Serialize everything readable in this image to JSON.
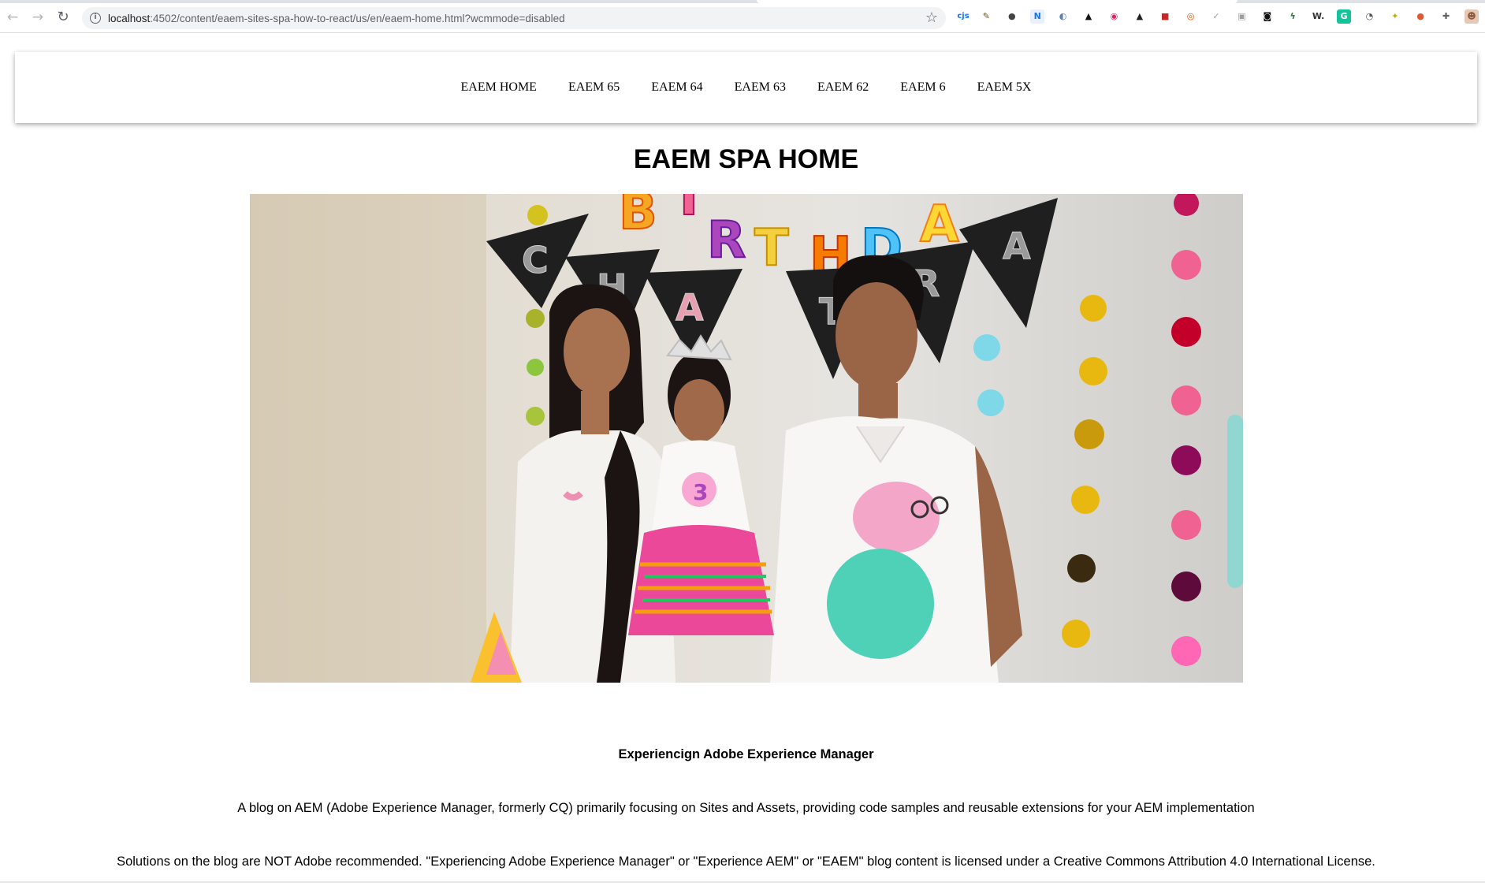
{
  "browser": {
    "url_host": "localhost",
    "url_path": ":4502/content/eaem-sites-spa-how-to-react/us/en/eaem-home.html?wcmmode=disabled",
    "icons": {
      "back": "back-arrow-icon",
      "forward": "forward-arrow-icon",
      "reload": "reload-icon",
      "site_info": "info-icon",
      "bookmark": "star-icon"
    },
    "extensions": [
      {
        "name": "cjs-extension-icon",
        "glyph": "cjs",
        "color": "#1a73e8",
        "bg": "transparent"
      },
      {
        "name": "pen-extension-icon",
        "glyph": "✎",
        "color": "#6b4e16",
        "bg": "transparent"
      },
      {
        "name": "circle-extension-icon",
        "glyph": "●",
        "color": "#444444",
        "bg": "transparent"
      },
      {
        "name": "n-extension-icon",
        "glyph": "N",
        "color": "#1a73e8",
        "bg": "#e8f0fe"
      },
      {
        "name": "compass-extension-icon",
        "glyph": "◐",
        "color": "#5b7fb5",
        "bg": "transparent"
      },
      {
        "name": "hat-extension-icon",
        "glyph": "▲",
        "color": "#111111",
        "bg": "transparent"
      },
      {
        "name": "record-extension-icon",
        "glyph": "◉",
        "color": "#e91e63",
        "bg": "transparent"
      },
      {
        "name": "drive-extension-icon",
        "glyph": "▲",
        "color": "#202124",
        "bg": "transparent"
      },
      {
        "name": "red-square-extension-icon",
        "glyph": "■",
        "color": "#c62828",
        "bg": "transparent"
      },
      {
        "name": "ring-extension-icon",
        "glyph": "◎",
        "color": "#e65100",
        "bg": "transparent"
      },
      {
        "name": "check-extension-icon",
        "glyph": "✓",
        "color": "#9e9e9e",
        "bg": "transparent"
      },
      {
        "name": "box-extension-icon",
        "glyph": "▣",
        "color": "#9e9e9e",
        "bg": "transparent"
      },
      {
        "name": "dark-box-extension-icon",
        "glyph": "◙",
        "color": "#111111",
        "bg": "transparent"
      },
      {
        "name": "leaf-extension-icon",
        "glyph": "ϟ",
        "color": "#2e7d32",
        "bg": "transparent"
      },
      {
        "name": "w-extension-icon",
        "glyph": "W.",
        "color": "#333333",
        "bg": "transparent"
      },
      {
        "name": "grammarly-extension-icon",
        "glyph": "G",
        "color": "#ffffff",
        "bg": "#15c39a"
      },
      {
        "name": "search-extension-icon",
        "glyph": "◔",
        "color": "#555555",
        "bg": "transparent"
      },
      {
        "name": "sparkle-extension-icon",
        "glyph": "✦",
        "color": "#c0b000",
        "bg": "transparent"
      },
      {
        "name": "duck-extension-icon",
        "glyph": "●",
        "color": "#de5833",
        "bg": "transparent"
      },
      {
        "name": "puzzle-extensions-icon",
        "glyph": "✚",
        "color": "#5f6368",
        "bg": "transparent"
      },
      {
        "name": "profile-avatar-icon",
        "glyph": "☻",
        "color": "#8d5b3f",
        "bg": "#e6c9b4"
      }
    ]
  },
  "nav": {
    "items": [
      "EAEM HOME",
      "EAEM 65",
      "EAEM 64",
      "EAEM 63",
      "EAEM 62",
      "EAEM 6",
      "EAEM 5X"
    ]
  },
  "page": {
    "title": "EAEM SPA HOME",
    "hero_image": "family-birthday-photo",
    "heading": "Experiencign Adobe Experience Manager",
    "description": "A blog on AEM (Adobe Experience Manager, formerly CQ) primarily focusing on Sites and Assets, providing code samples and reusable extensions for your AEM implementation",
    "license": "Solutions on the blog are NOT Adobe recommended. \"Experiencing Adobe Experience Manager\" or \"Experience AEM\" or \"EAEM\" blog content is licensed under a Creative Commons Attribution 4.0 International License.",
    "banner_letters_top": [
      "B",
      "I",
      "R",
      "T",
      "H",
      "D",
      "A"
    ],
    "banner_letters_flags": [
      "C",
      "H",
      "A",
      "T",
      "R",
      "A"
    ]
  }
}
